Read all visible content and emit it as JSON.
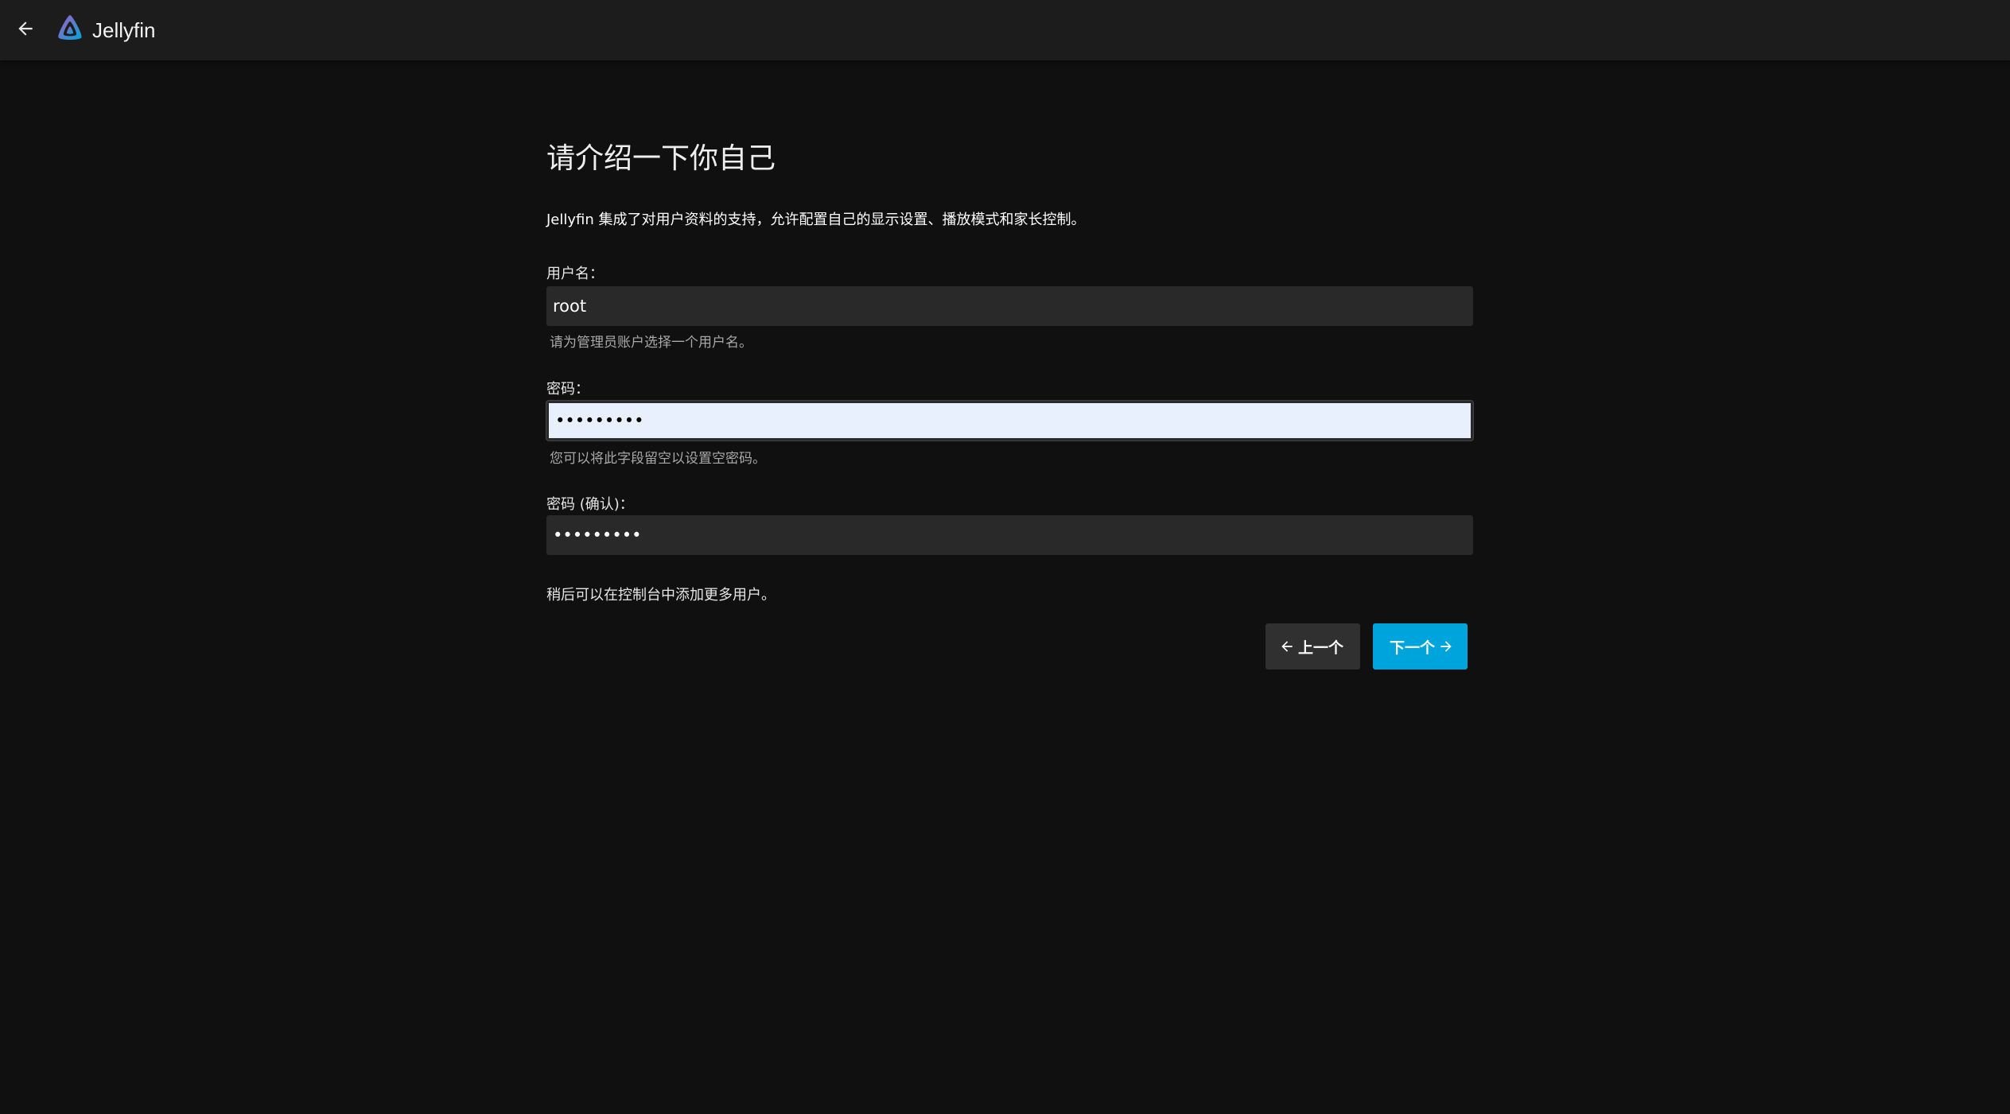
{
  "header": {
    "back_icon": "arrow-left-icon",
    "app_name": "Jellyfin",
    "logo_icon": "jellyfin-logo-icon"
  },
  "page": {
    "title": "请介绍一下你自己",
    "intro": "Jellyfin 集成了对用户资料的支持，允许配置自己的显示设置、播放模式和家长控制。"
  },
  "form": {
    "username": {
      "label": "用户名：",
      "value": "root",
      "helper": "请为管理员账户选择一个用户名。"
    },
    "password": {
      "label": "密码：",
      "value": "•••••••••",
      "helper": "您可以将此字段留空以设置空密码。"
    },
    "password_confirm": {
      "label": "密码 (确认)：",
      "value": "•••••••••"
    },
    "footer_note": "稍后可以在控制台中添加更多用户。"
  },
  "buttons": {
    "previous": "上一个",
    "next": "下一个"
  },
  "colors": {
    "accent": "#00a4dc",
    "background": "#101010",
    "topbar": "#1c1c1c"
  }
}
